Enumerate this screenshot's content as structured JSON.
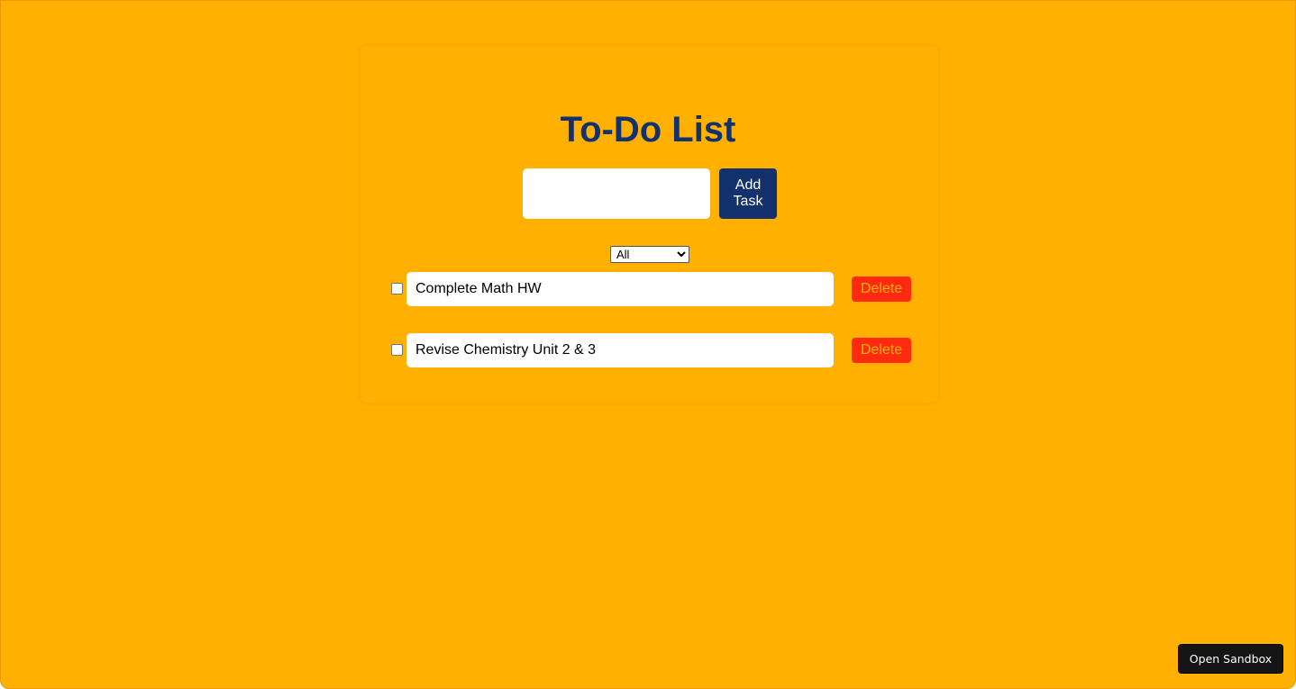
{
  "app": {
    "title": "To-Do List"
  },
  "add_form": {
    "input_value": "",
    "input_placeholder": "",
    "add_button_label": "Add Task"
  },
  "filter": {
    "selected": "All"
  },
  "tasks": [
    {
      "text": "Complete Math HW",
      "completed": false,
      "delete_label": "Delete"
    },
    {
      "text": "Revise Chemistry Unit 2 & 3",
      "completed": false,
      "delete_label": "Delete"
    }
  ],
  "footer": {
    "sandbox_button_label": "Open Sandbox"
  },
  "colors": {
    "background": "#ffb000",
    "title": "#12316d",
    "add_button": "#12316d",
    "delete_button": "#ff2a0f",
    "delete_text": "#f5b800",
    "sandbox_button": "#151515"
  }
}
